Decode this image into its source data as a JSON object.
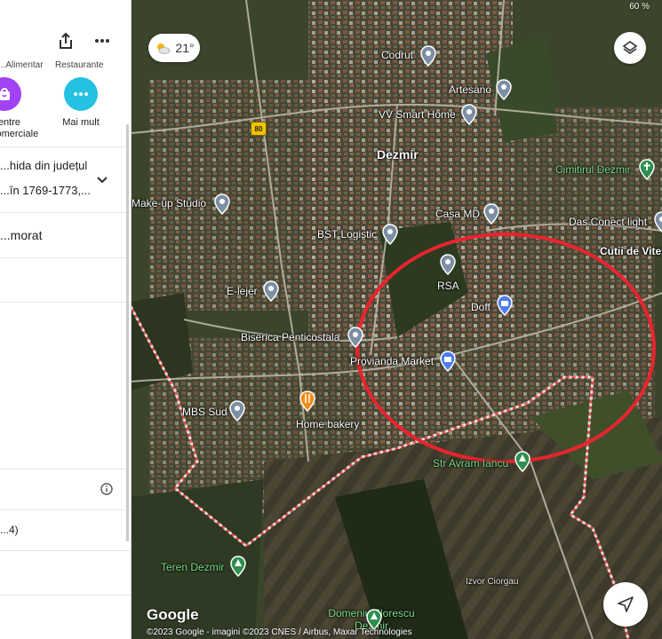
{
  "panel": {
    "cut_categories": [
      "...Alimentar",
      "Restaurante"
    ],
    "actions": [
      {
        "icon": "shopping-bag-icon",
        "label_line1": "Centre",
        "label_line2": "comerciale",
        "color": "#a142f4"
      },
      {
        "icon": "more-dots-icon",
        "label_line1": "Mai mult",
        "label_line2": "",
        "color": "#24c1e0"
      }
    ],
    "history_line1": "...hida din județul",
    "history_line2": "...în 1769-1773,...",
    "row_label": "...morat",
    "row_number": "...4)"
  },
  "map": {
    "weather": {
      "temp": "21°",
      "icon": "partly-cloudy-icon"
    },
    "road_number": "80",
    "places": [
      {
        "name": "Codrut",
        "kind": "poi"
      },
      {
        "name": "Artesano",
        "kind": "poi"
      },
      {
        "name": "VV Smart Home",
        "kind": "poi"
      },
      {
        "name": "Dezmir",
        "kind": "town"
      },
      {
        "name": "Cimitirul Dezmir",
        "kind": "green"
      },
      {
        "name": "Make-up Studio",
        "kind": "poi"
      },
      {
        "name": "Casa MD",
        "kind": "poi"
      },
      {
        "name": "Das Conect light",
        "kind": "poi"
      },
      {
        "name": "BST Logistic",
        "kind": "poi"
      },
      {
        "name": "Cutii de Vitez",
        "kind": "bold"
      },
      {
        "name": "RSA",
        "kind": "poi"
      },
      {
        "name": "E-lejer",
        "kind": "poi"
      },
      {
        "name": "Doff",
        "kind": "shop"
      },
      {
        "name": "Biserica Penticostala",
        "kind": "poi"
      },
      {
        "name": "Provianda Market",
        "kind": "shop"
      },
      {
        "name": "MBS Sud",
        "kind": "poi"
      },
      {
        "name": "Home bakery",
        "kind": "food"
      },
      {
        "name": "Str Avram Iancu",
        "kind": "green"
      },
      {
        "name": "Teren Dezmir",
        "kind": "green"
      },
      {
        "name": "Izvor Ciorgau",
        "kind": "small"
      },
      {
        "name": "Domeniu Florescu Dezmir",
        "kind": "green"
      }
    ],
    "google_logo": "Google",
    "copyright": "©2023 Google - imagini ©2023 CNES / Airbus, Maxar Technologies",
    "status_battery": "60 %",
    "highlight_color": "#e8242f",
    "boundary_color": "#ff4d4d"
  }
}
